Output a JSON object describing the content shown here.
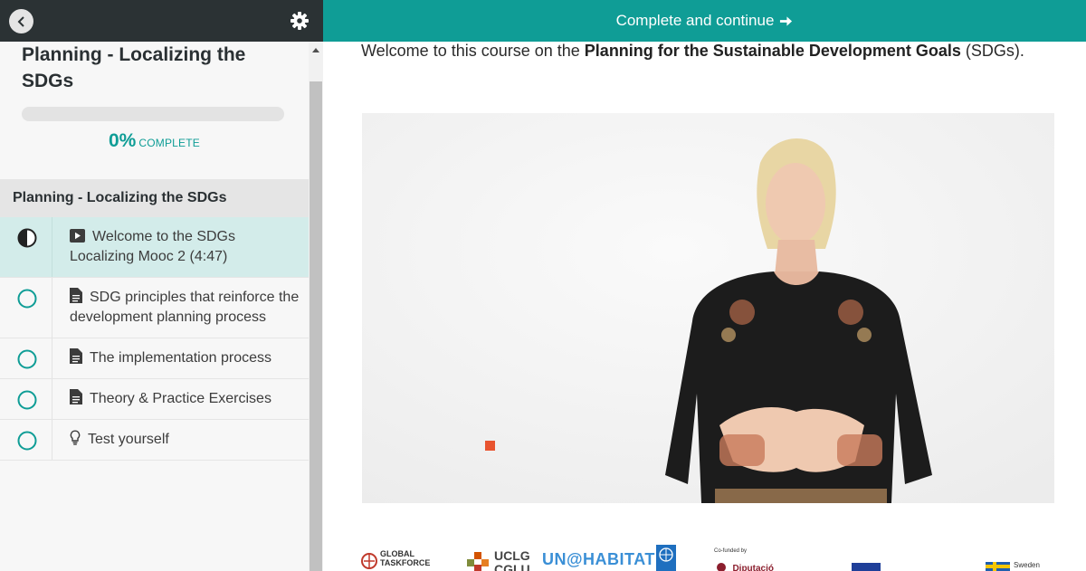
{
  "course": {
    "title": "Planning - Localizing the SDGs",
    "progress": {
      "percent_label": "0%",
      "value": 0,
      "complete_label": "COMPLETE"
    }
  },
  "header": {
    "complete_button_label": "Complete and continue",
    "back_icon": "chevron-left-icon",
    "settings_icon": "gear-icon"
  },
  "section": {
    "title": "Planning - Localizing the SDGs",
    "lessons": [
      {
        "label": "Welcome to the SDGs Localizing Mooc 2 (4:47)",
        "type": "video",
        "status": "in-progress",
        "active": true
      },
      {
        "label": "SDG principles that reinforce the development planning process",
        "type": "text",
        "status": "not-started",
        "active": false
      },
      {
        "label": "The implementation process",
        "type": "text",
        "status": "not-started",
        "active": false
      },
      {
        "label": "Theory & Practice Exercises",
        "type": "text",
        "status": "not-started",
        "active": false
      },
      {
        "label": "Test yourself",
        "type": "quiz",
        "status": "not-started",
        "active": false
      }
    ]
  },
  "main": {
    "intro_prefix": "Welcome to this course on the ",
    "intro_bold": "Planning for the Sustainable Development Goals",
    "intro_suffix": " (SDGs).",
    "logos": {
      "gtf_line1": "GLOBAL",
      "gtf_line2": "TASKFORCE",
      "uclg_line1": "UCLG",
      "uclg_line2": "CGLU",
      "unhabitat": "UN@HABITAT",
      "cofunded": "Co-funded by",
      "diputacio": "Diputació",
      "sweden": "Sweden"
    }
  },
  "colors": {
    "accent": "#0f9d96",
    "sidebar_dark": "#2b3234",
    "active_row": "#d3ecea"
  }
}
